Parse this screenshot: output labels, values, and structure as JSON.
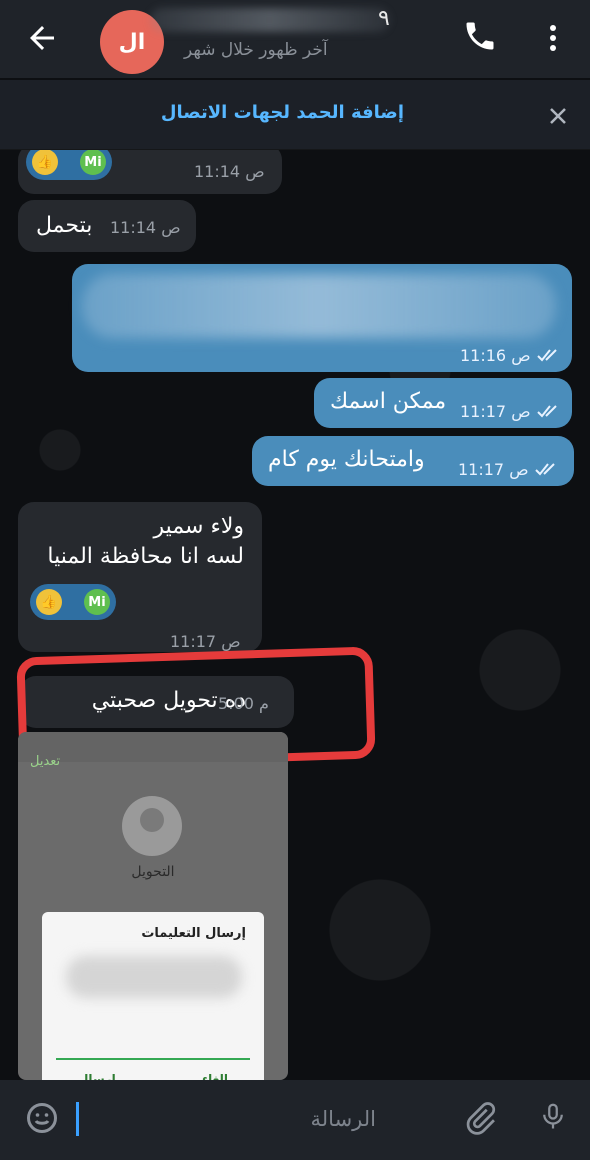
{
  "header": {
    "avatar_initials": "ال",
    "name_visible_tail": "٩",
    "last_seen": "آخر ظهور خلال شهر"
  },
  "banner": {
    "add_contact_text": "إضافة الحمد لجهات الاتصال"
  },
  "messages": [
    {
      "time": "11:14 ص"
    },
    {
      "text": "بتحمل",
      "time": "11:14 ص"
    },
    {
      "time": "11:16 ص"
    },
    {
      "text": "ممكن اسمك",
      "time": "11:17 ص"
    },
    {
      "text": "وامتحانك يوم كام",
      "time": "11:17 ص"
    },
    {
      "line1": "ولاء سمير",
      "line2": "لسه انا محافظة المنيا",
      "time": "11:17 ص"
    },
    {
      "text": "ده تحويل صحبتي",
      "time": "5:00 م"
    }
  ],
  "embedded_screenshot": {
    "edit_label": "تعديل",
    "contact_name": "التحويل",
    "dialog_title": "إرسال التعليمات",
    "send_label": "ارسال",
    "cancel_label": "الغاء"
  },
  "composer": {
    "placeholder": "الرسالة"
  },
  "icons": {
    "back": "arrow-left-icon",
    "call": "phone-icon",
    "more": "vertical-dots-icon",
    "close": "close-icon",
    "emoji": "smiley-icon",
    "attach": "paperclip-icon",
    "mic": "microphone-icon",
    "scroll": "chevron-down-icon"
  },
  "colors": {
    "accent": "#57b7ff",
    "outgoing_bubble": "#4a8dbb",
    "highlight": "#e53b3b"
  }
}
